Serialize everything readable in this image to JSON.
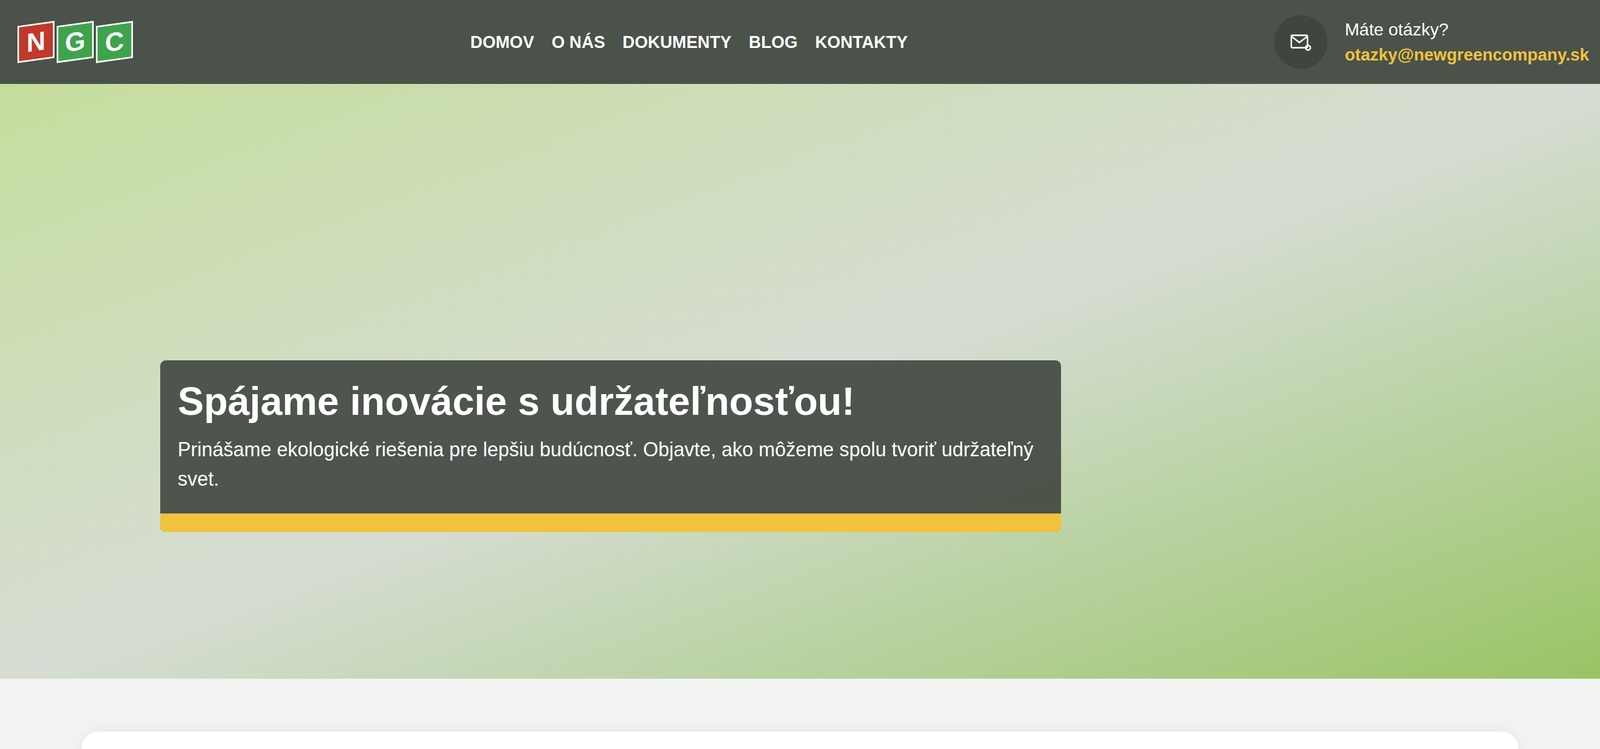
{
  "header": {
    "logo": [
      {
        "letter": "N",
        "color": "#c0392b"
      },
      {
        "letter": "G",
        "color": "#3fa34d"
      },
      {
        "letter": "C",
        "color": "#3fa34d"
      }
    ],
    "nav": [
      {
        "label": "DOMOV",
        "selected": false
      },
      {
        "label": "O NÁS",
        "selected": false
      },
      {
        "label": "DOKUMENTY",
        "selected": false
      },
      {
        "label": "BLOG",
        "selected": false
      },
      {
        "label": "KONTAKTY",
        "selected": false
      }
    ],
    "contact": {
      "question": "Máte otázky?",
      "email": "otazky@newgreencompany.sk"
    }
  },
  "hero": {
    "title": "Spájame inovácie s udržateľnosťou!",
    "subtitle": "Prinášame ekologické riešenia pre lepšiu budúcnosť. Objavte, ako môžeme spolu tvoriť udržateľný svet."
  }
}
